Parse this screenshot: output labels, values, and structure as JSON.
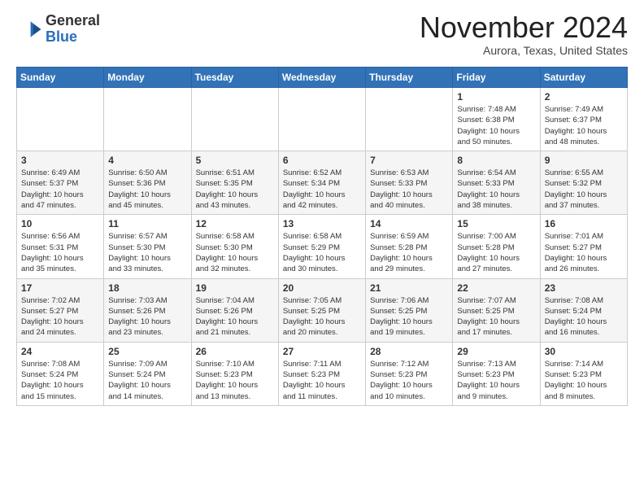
{
  "header": {
    "logo_general": "General",
    "logo_blue": "Blue",
    "month_title": "November 2024",
    "location": "Aurora, Texas, United States"
  },
  "weekdays": [
    "Sunday",
    "Monday",
    "Tuesday",
    "Wednesday",
    "Thursday",
    "Friday",
    "Saturday"
  ],
  "weeks": [
    [
      {
        "day": "",
        "info": ""
      },
      {
        "day": "",
        "info": ""
      },
      {
        "day": "",
        "info": ""
      },
      {
        "day": "",
        "info": ""
      },
      {
        "day": "",
        "info": ""
      },
      {
        "day": "1",
        "info": "Sunrise: 7:48 AM\nSunset: 6:38 PM\nDaylight: 10 hours\nand 50 minutes."
      },
      {
        "day": "2",
        "info": "Sunrise: 7:49 AM\nSunset: 6:37 PM\nDaylight: 10 hours\nand 48 minutes."
      }
    ],
    [
      {
        "day": "3",
        "info": "Sunrise: 6:49 AM\nSunset: 5:37 PM\nDaylight: 10 hours\nand 47 minutes."
      },
      {
        "day": "4",
        "info": "Sunrise: 6:50 AM\nSunset: 5:36 PM\nDaylight: 10 hours\nand 45 minutes."
      },
      {
        "day": "5",
        "info": "Sunrise: 6:51 AM\nSunset: 5:35 PM\nDaylight: 10 hours\nand 43 minutes."
      },
      {
        "day": "6",
        "info": "Sunrise: 6:52 AM\nSunset: 5:34 PM\nDaylight: 10 hours\nand 42 minutes."
      },
      {
        "day": "7",
        "info": "Sunrise: 6:53 AM\nSunset: 5:33 PM\nDaylight: 10 hours\nand 40 minutes."
      },
      {
        "day": "8",
        "info": "Sunrise: 6:54 AM\nSunset: 5:33 PM\nDaylight: 10 hours\nand 38 minutes."
      },
      {
        "day": "9",
        "info": "Sunrise: 6:55 AM\nSunset: 5:32 PM\nDaylight: 10 hours\nand 37 minutes."
      }
    ],
    [
      {
        "day": "10",
        "info": "Sunrise: 6:56 AM\nSunset: 5:31 PM\nDaylight: 10 hours\nand 35 minutes."
      },
      {
        "day": "11",
        "info": "Sunrise: 6:57 AM\nSunset: 5:30 PM\nDaylight: 10 hours\nand 33 minutes."
      },
      {
        "day": "12",
        "info": "Sunrise: 6:58 AM\nSunset: 5:30 PM\nDaylight: 10 hours\nand 32 minutes."
      },
      {
        "day": "13",
        "info": "Sunrise: 6:58 AM\nSunset: 5:29 PM\nDaylight: 10 hours\nand 30 minutes."
      },
      {
        "day": "14",
        "info": "Sunrise: 6:59 AM\nSunset: 5:28 PM\nDaylight: 10 hours\nand 29 minutes."
      },
      {
        "day": "15",
        "info": "Sunrise: 7:00 AM\nSunset: 5:28 PM\nDaylight: 10 hours\nand 27 minutes."
      },
      {
        "day": "16",
        "info": "Sunrise: 7:01 AM\nSunset: 5:27 PM\nDaylight: 10 hours\nand 26 minutes."
      }
    ],
    [
      {
        "day": "17",
        "info": "Sunrise: 7:02 AM\nSunset: 5:27 PM\nDaylight: 10 hours\nand 24 minutes."
      },
      {
        "day": "18",
        "info": "Sunrise: 7:03 AM\nSunset: 5:26 PM\nDaylight: 10 hours\nand 23 minutes."
      },
      {
        "day": "19",
        "info": "Sunrise: 7:04 AM\nSunset: 5:26 PM\nDaylight: 10 hours\nand 21 minutes."
      },
      {
        "day": "20",
        "info": "Sunrise: 7:05 AM\nSunset: 5:25 PM\nDaylight: 10 hours\nand 20 minutes."
      },
      {
        "day": "21",
        "info": "Sunrise: 7:06 AM\nSunset: 5:25 PM\nDaylight: 10 hours\nand 19 minutes."
      },
      {
        "day": "22",
        "info": "Sunrise: 7:07 AM\nSunset: 5:25 PM\nDaylight: 10 hours\nand 17 minutes."
      },
      {
        "day": "23",
        "info": "Sunrise: 7:08 AM\nSunset: 5:24 PM\nDaylight: 10 hours\nand 16 minutes."
      }
    ],
    [
      {
        "day": "24",
        "info": "Sunrise: 7:08 AM\nSunset: 5:24 PM\nDaylight: 10 hours\nand 15 minutes."
      },
      {
        "day": "25",
        "info": "Sunrise: 7:09 AM\nSunset: 5:24 PM\nDaylight: 10 hours\nand 14 minutes."
      },
      {
        "day": "26",
        "info": "Sunrise: 7:10 AM\nSunset: 5:23 PM\nDaylight: 10 hours\nand 13 minutes."
      },
      {
        "day": "27",
        "info": "Sunrise: 7:11 AM\nSunset: 5:23 PM\nDaylight: 10 hours\nand 11 minutes."
      },
      {
        "day": "28",
        "info": "Sunrise: 7:12 AM\nSunset: 5:23 PM\nDaylight: 10 hours\nand 10 minutes."
      },
      {
        "day": "29",
        "info": "Sunrise: 7:13 AM\nSunset: 5:23 PM\nDaylight: 10 hours\nand 9 minutes."
      },
      {
        "day": "30",
        "info": "Sunrise: 7:14 AM\nSunset: 5:23 PM\nDaylight: 10 hours\nand 8 minutes."
      }
    ]
  ]
}
